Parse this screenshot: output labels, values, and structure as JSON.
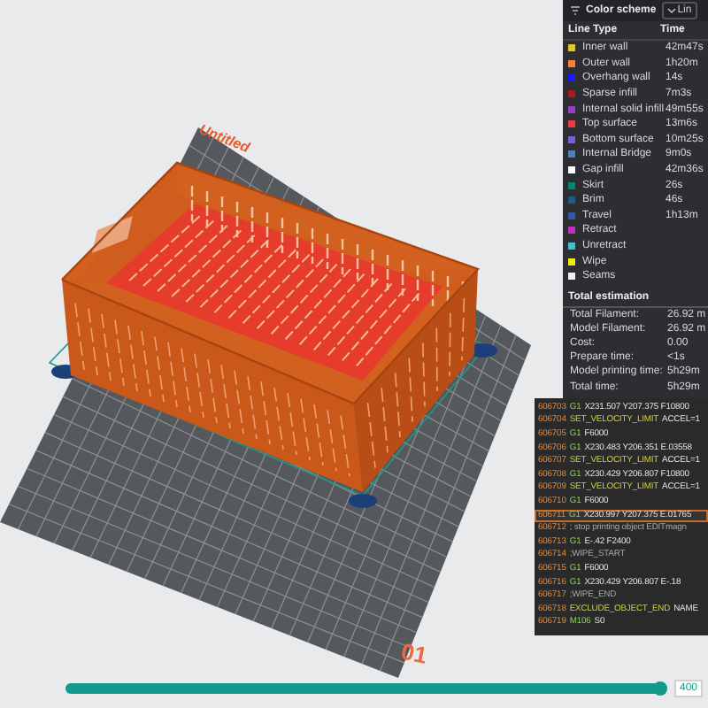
{
  "scene": {
    "plate_name": "Untitled",
    "plate_number": "01"
  },
  "legend": {
    "title": "Color scheme",
    "view_select": "Lin",
    "columns": [
      "Line Type",
      "Time"
    ],
    "items": [
      {
        "name": "Inner wall",
        "time": "42m47s",
        "color": "#e6c619"
      },
      {
        "name": "Outer wall",
        "time": "1h20m",
        "color": "#ff7f3a"
      },
      {
        "name": "Overhang wall",
        "time": "14s",
        "color": "#1a1aff"
      },
      {
        "name": "Sparse infill",
        "time": "7m3s",
        "color": "#b01a1a"
      },
      {
        "name": "Internal solid infill",
        "time": "49m55s",
        "color": "#9a3cc6"
      },
      {
        "name": "Top surface",
        "time": "13m6s",
        "color": "#f03c3c"
      },
      {
        "name": "Bottom surface",
        "time": "10m25s",
        "color": "#7b5cd9"
      },
      {
        "name": "Internal Bridge",
        "time": "9m0s",
        "color": "#4d80ba"
      },
      {
        "name": "Gap infill",
        "time": "42m36s",
        "color": "#ffffff"
      },
      {
        "name": "Skirt",
        "time": "26s",
        "color": "#00876e"
      },
      {
        "name": "Brim",
        "time": "46s",
        "color": "#1e5a8a"
      },
      {
        "name": "Travel",
        "time": "1h13m",
        "color": "#3856a8"
      },
      {
        "name": "Retract",
        "color": "#c030c0"
      },
      {
        "name": "Unretract",
        "color": "#40c0d0"
      },
      {
        "name": "Wipe",
        "color": "#f0f000"
      },
      {
        "name": "Seams",
        "color": "#f0f0f0"
      }
    ],
    "estimation": {
      "title": "Total estimation",
      "rows": [
        {
          "label": "Total Filament:",
          "value": "26.92 m"
        },
        {
          "label": "Model Filament:",
          "value": "26.92 m"
        },
        {
          "label": "Cost:",
          "value": "0.00"
        },
        {
          "label": "Prepare time:",
          "value": "<1s"
        },
        {
          "label": "Model printing time:",
          "value": "5h29m"
        },
        {
          "label": "Total time:",
          "value": "5h29m"
        }
      ]
    }
  },
  "gcode": {
    "lines": [
      {
        "number": "606703",
        "command": "G1",
        "args": "X231.507 Y207.375 F10800",
        "kind": "move",
        "selected": false
      },
      {
        "number": "606704",
        "command": "SET_VELOCITY_LIMIT",
        "args": "ACCEL=1",
        "kind": "macro",
        "selected": false
      },
      {
        "number": "606705",
        "command": "G1",
        "args": "F6000",
        "kind": "move",
        "selected": false
      },
      {
        "number": "606706",
        "command": "G1",
        "args": "X230.483 Y206.351 E.03558",
        "kind": "move",
        "selected": false
      },
      {
        "number": "606707",
        "command": "SET_VELOCITY_LIMIT",
        "args": "ACCEL=1",
        "kind": "macro",
        "selected": false
      },
      {
        "number": "606708",
        "command": "G1",
        "args": "X230.429 Y206.807 F10800",
        "kind": "move",
        "selected": false
      },
      {
        "number": "606709",
        "command": "SET_VELOCITY_LIMIT",
        "args": "ACCEL=1",
        "kind": "macro",
        "selected": false
      },
      {
        "number": "606710",
        "command": "G1",
        "args": "F6000",
        "kind": "move",
        "selected": false
      },
      {
        "number": "606711",
        "command": "G1",
        "args": "X230.997 Y207.375 E.01765",
        "kind": "move",
        "selected": true
      },
      {
        "number": "606712",
        "command": "; stop printing object EDITmagn",
        "kind": "comment",
        "selected": false
      },
      {
        "number": "606713",
        "command": "G1",
        "args": "E-.42 F2400",
        "kind": "move",
        "selected": false
      },
      {
        "number": "606714",
        "command": ";WIPE_START",
        "kind": "comment",
        "selected": false
      },
      {
        "number": "606715",
        "command": "G1",
        "args": "F6000",
        "kind": "move",
        "selected": false
      },
      {
        "number": "606716",
        "command": "G1",
        "args": "X230.429 Y206.807 E-.18",
        "kind": "move",
        "selected": false
      },
      {
        "number": "606717",
        "command": ";WIPE_END",
        "kind": "comment",
        "selected": false
      },
      {
        "number": "606718",
        "command": "EXCLUDE_OBJECT_END",
        "args": "NAME",
        "kind": "macro",
        "selected": false
      },
      {
        "number": "606719",
        "command": "M106",
        "args": "S0",
        "kind": "move",
        "selected": false
      }
    ]
  },
  "layer_slider": {
    "level": 0.99,
    "value": "400"
  }
}
